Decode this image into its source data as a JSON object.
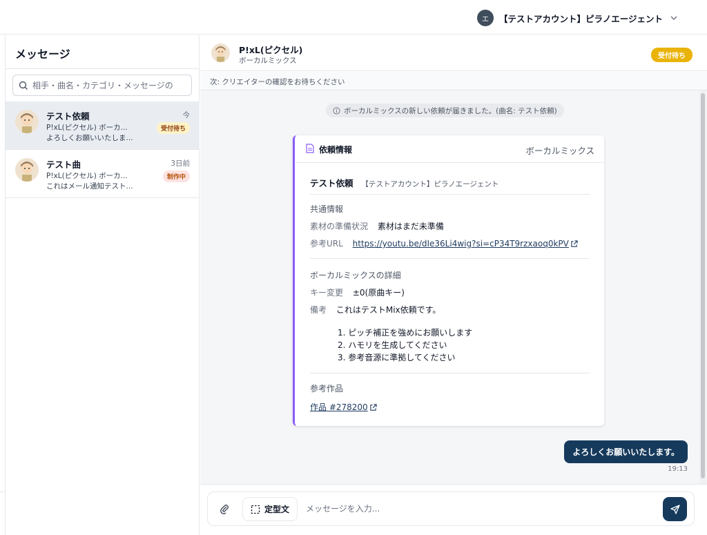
{
  "header": {
    "account_initial": "エ",
    "account_name": "【テストアカウント】ピラノエージェント"
  },
  "sidebar": {
    "title": "メッセージ",
    "search_placeholder": "相手・曲名・カテゴリ・メッセージの",
    "conversations": [
      {
        "title": "テスト依頼",
        "line1": "P!xL(ピクセル) ボーカ...",
        "line2": "よろしくお願いいたしま...",
        "time": "今",
        "status": "受付待ち"
      },
      {
        "title": "テスト曲",
        "line1": "P!xL(ピクセル) ボーカ...",
        "line2": "これはメール通知テスト...",
        "time": "3日前",
        "status": "制作中"
      }
    ]
  },
  "chat": {
    "creator_name": "P!xL(ピクセル)",
    "creator_sub": "ボーカルミックス",
    "status_badge": "受付待ち",
    "next_step": "次: クリエイターの確認をお待ちください",
    "system_message": "ボーカルミックスの新しい依頼が届きました。(曲名: テスト依頼)",
    "card": {
      "title": "依頼情報",
      "type": "ボーカルミックス",
      "request_title": "テスト依頼",
      "request_account": "【テストアカウント】ピラノエージェント",
      "common_title": "共通情報",
      "material_label": "素材の準備状況",
      "material_value": "素材はまだ未準備",
      "ref_url_label": "参考URL",
      "ref_url_value": "https://youtu.be/dIe36Li4wig?si=cP34T9rzxaoq0kPV",
      "detail_title": "ボーカルミックスの詳細",
      "key_label": "キー変更",
      "key_value": "±0(原曲キー)",
      "notes_label": "備考",
      "notes_intro": "これはテストMix依頼です。",
      "notes_items": [
        "1. ピッチ補正を強めにお願いします",
        "2. ハモリを生成してください",
        "3. 参考音源に準拠してください"
      ],
      "ref_work_title": "参考作品",
      "ref_work_link": "作品 #278200"
    },
    "my_message": "よろしくお願いいたします。",
    "my_message_time": "19:13",
    "template_button": "定型文",
    "input_placeholder": "メッセージを入力..."
  },
  "colors": {
    "navy": "#163a5c",
    "badge_yellow": "#eab308",
    "card_accent": "#8b5cf6",
    "active_row": "#e9edf2"
  },
  "icons": [
    "chevron-down-icon",
    "search-icon",
    "info-icon",
    "document-icon",
    "external-link-icon",
    "paperclip-icon",
    "template-icon",
    "send-icon"
  ]
}
